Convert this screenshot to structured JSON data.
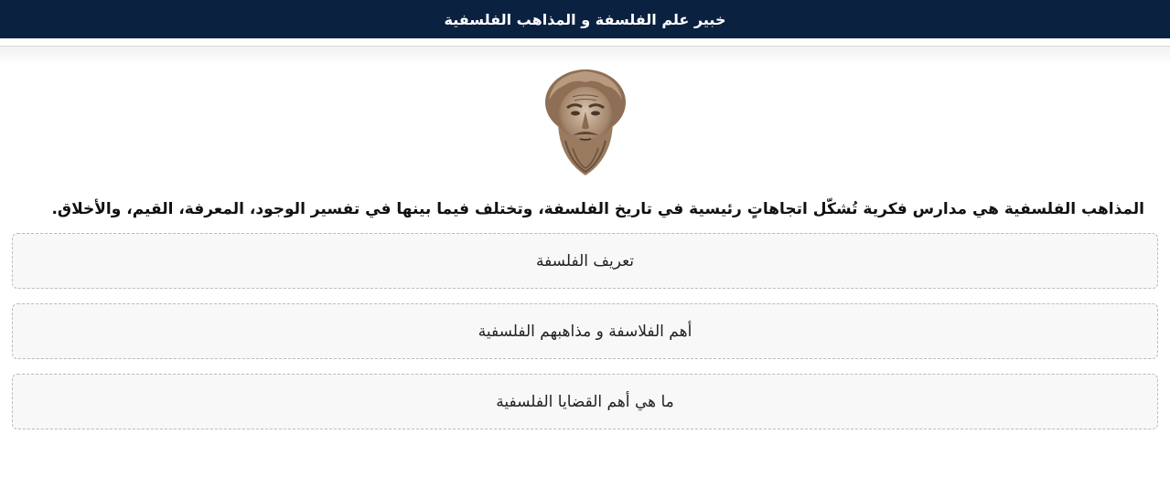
{
  "header": {
    "title": "خبير علم الفلسفة و المذاهب الفلسفية"
  },
  "intro": {
    "text": "المذاهب الفلسفية هي مدارس فكرية تُشكّل اتجاهاتٍ رئيسية في تاريخ الفلسفة، وتختلف فيما بينها في تفسير الوجود، المعرفة، القيم، والأخلاق."
  },
  "options": [
    {
      "label": "تعريف الفلسفة"
    },
    {
      "label": "أهم الفلاسفة و مذاهبهم الفلسفية"
    },
    {
      "label": "ما هي أهم القضايا الفلسفية"
    }
  ]
}
